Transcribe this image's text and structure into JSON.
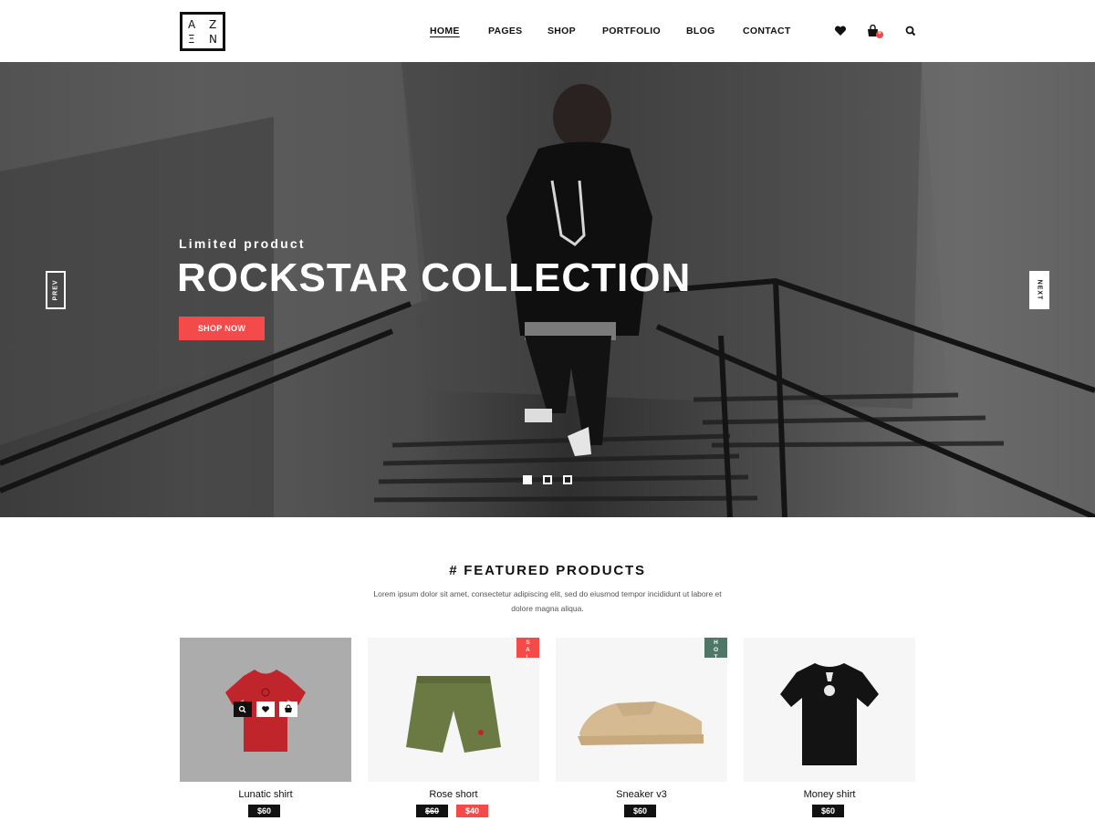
{
  "logo": {
    "letters": [
      "A",
      "Z",
      "Ξ",
      "N"
    ]
  },
  "nav": {
    "items": [
      {
        "label": "HOME",
        "active": true
      },
      {
        "label": "PAGES",
        "active": false
      },
      {
        "label": "SHOP",
        "active": false
      },
      {
        "label": "PORTFOLIO",
        "active": false
      },
      {
        "label": "BLOG",
        "active": false
      },
      {
        "label": "CONTACT",
        "active": false
      }
    ],
    "cart_count": "0",
    "icons": [
      "heart-icon",
      "cart-icon",
      "search-icon"
    ]
  },
  "hero": {
    "subtitle": "Limited product",
    "title": "ROCKSTAR COLLECTION",
    "button": "SHOP NOW",
    "prev": "PREV",
    "next": "NEXT",
    "slides": 3,
    "active_slide": 1
  },
  "featured": {
    "title": "# FEATURED PRODUCTS",
    "description": "Lorem ipsum dolor sit amet, consectetur adipiscing elit, sed do eiusmod tempor incididunt ut labore et dolore magna aliqua.",
    "products": [
      {
        "name": "Lunatic shirt",
        "price": "$60"
      },
      {
        "name": "Rose short",
        "old_price": "$60",
        "price": "$40",
        "badge": "SALE"
      },
      {
        "name": "Sneaker v3",
        "price": "$60",
        "badge": "HOT"
      },
      {
        "name": "Money shirt",
        "price": "$60"
      }
    ]
  },
  "colors": {
    "accent": "#f44a4a",
    "hot": "#4e7767",
    "dark": "#111111"
  }
}
